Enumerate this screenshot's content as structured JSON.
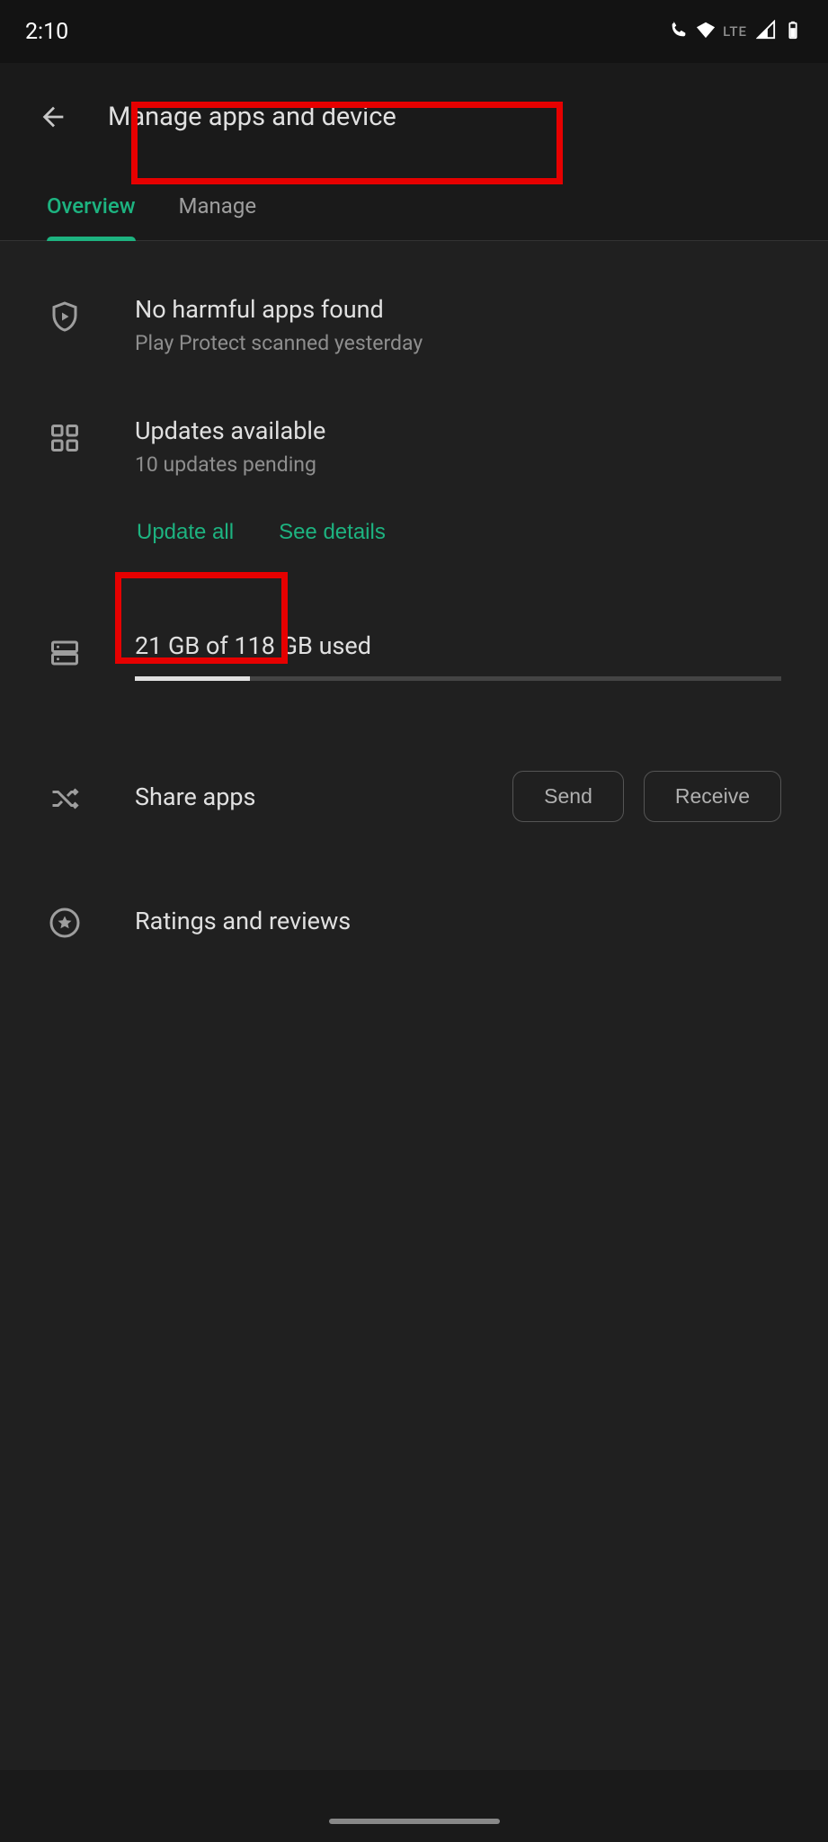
{
  "status": {
    "time": "2:10",
    "lte": "LTE"
  },
  "header": {
    "title": "Manage apps and device"
  },
  "tabs": {
    "overview": "Overview",
    "manage": "Manage"
  },
  "protect": {
    "title": "No harmful apps found",
    "sub": "Play Protect scanned yesterday"
  },
  "updates": {
    "title": "Updates available",
    "sub": "10 updates pending",
    "update_all": "Update all",
    "see_details": "See details"
  },
  "storage": {
    "text": "21 GB of 118 GB used"
  },
  "share": {
    "title": "Share apps",
    "send": "Send",
    "receive": "Receive"
  },
  "ratings": {
    "title": "Ratings and reviews"
  },
  "colors": {
    "accent": "#1db380",
    "highlight": "#e60000"
  }
}
